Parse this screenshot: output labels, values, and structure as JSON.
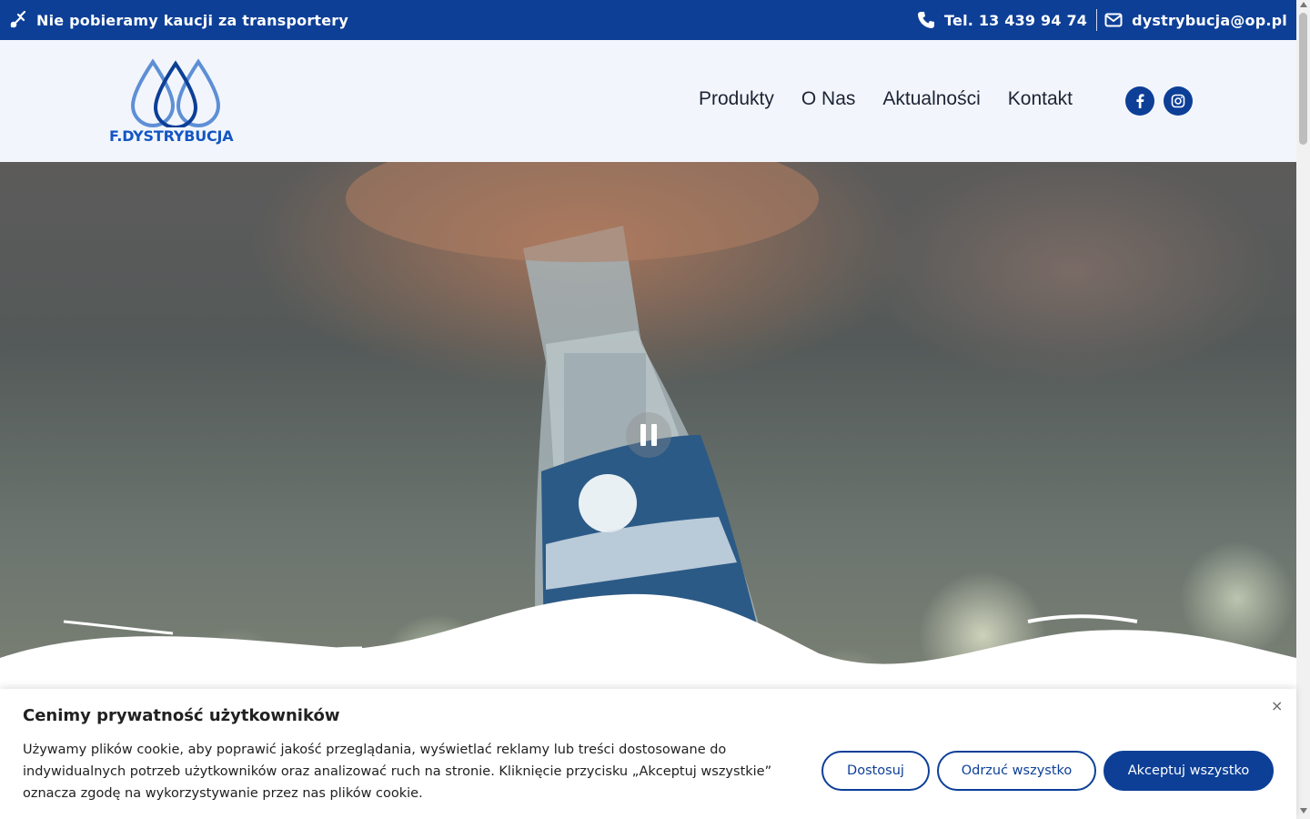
{
  "topbar": {
    "promo": "Nie pobieramy kaucji za transportery",
    "phone": "Tel. 13 439 94 74",
    "email": "dystrybucja@op.pl"
  },
  "header": {
    "logo_text": "F.DYSTRYBUCJA",
    "nav": [
      "Produkty",
      "O Nas",
      "Aktualności",
      "Kontakt"
    ],
    "social": [
      "facebook-icon",
      "instagram-icon"
    ]
  },
  "hero": {
    "video_state": "playing"
  },
  "cookie": {
    "title": "Cenimy prywatność użytkowników",
    "description": "Używamy plików cookie, aby poprawić jakość przeglądania, wyświetlać reklamy lub treści dostosowane do indywidualnych potrzeb użytkowników oraz analizować ruch na stronie. Kliknięcie przycisku „Akceptuj wszystkie” oznacza zgodę na wykorzystywanie przez nas plików cookie.",
    "btn_customize": "Dostosuj",
    "btn_reject": "Odrzuć wszystko",
    "btn_accept": "Akceptuj wszystko",
    "close": "×"
  },
  "colors": {
    "brand": "#0d3f97",
    "header_bg": "#f2f6fc",
    "logo_blue": "#1456c3"
  }
}
